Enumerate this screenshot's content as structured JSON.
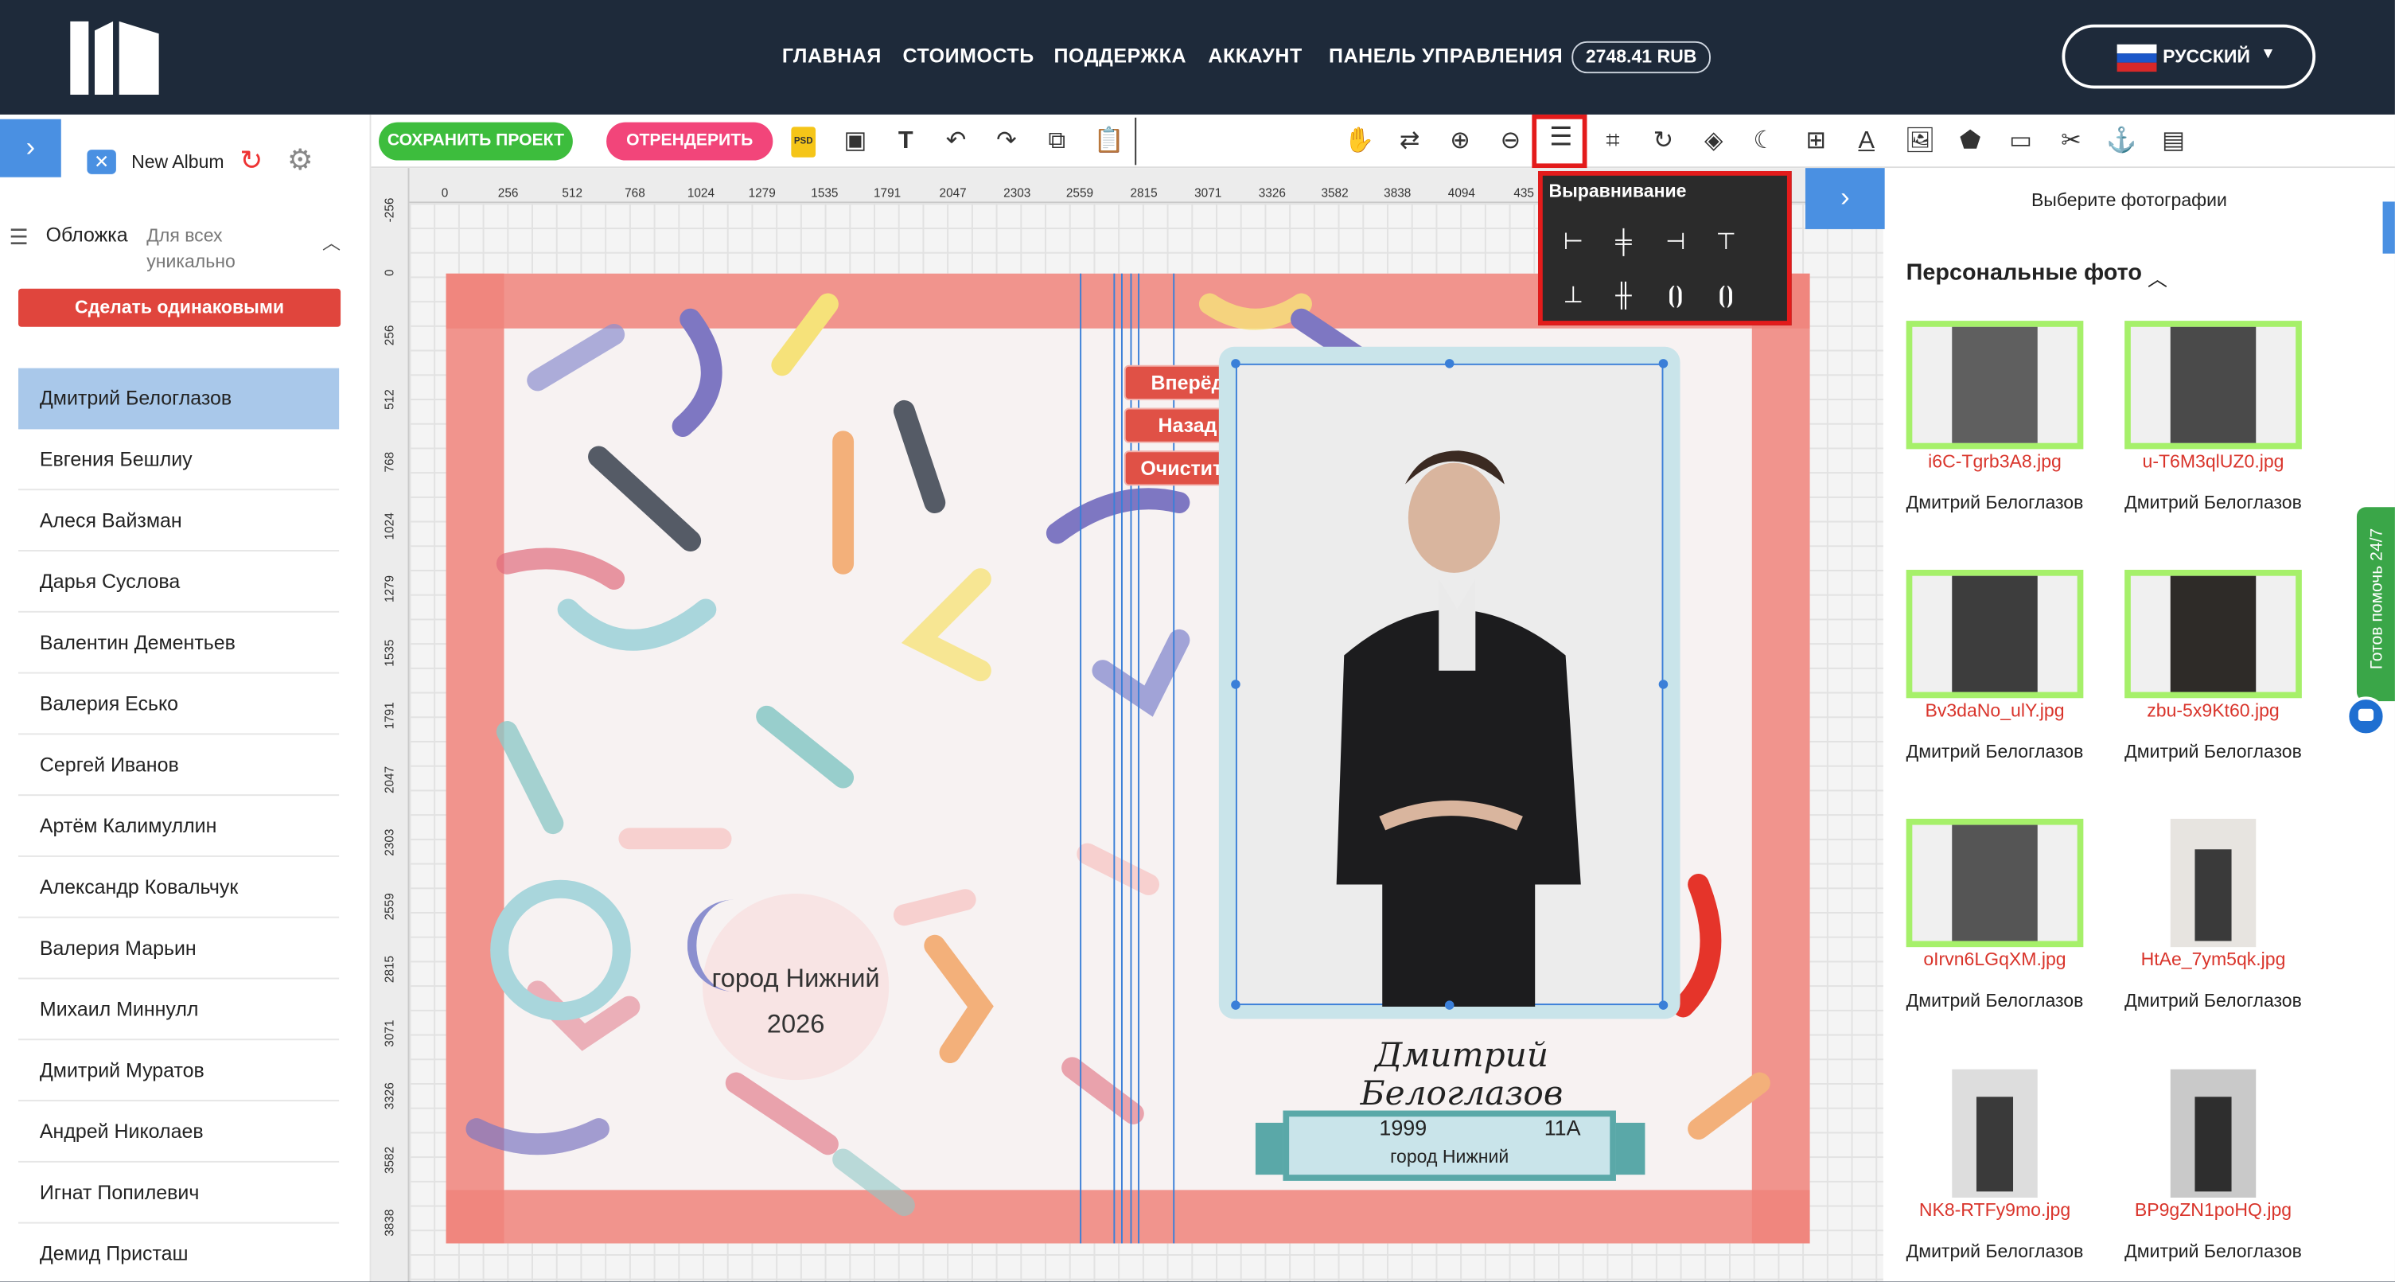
{
  "nav": {
    "links": [
      "ГЛАВНАЯ",
      "СТОИМОСТЬ",
      "ПОДДЕРЖКА",
      "АККАУНТ",
      "ПАНЕЛЬ УПРАВЛЕНИЯ"
    ],
    "balance": "2748.41 RUB",
    "language": "РУССКИЙ"
  },
  "album": {
    "name": "New Album"
  },
  "cover": {
    "label": "Обложка",
    "mode": "Для всех уникально",
    "make_same_button": "Сделать одинаковыми"
  },
  "people": [
    "Дмитрий Белоглазов",
    "Евгения Бешлиу",
    "Алеся Вайзман",
    "Дарья Суслова",
    "Валентин Дементьев",
    "Валерия Есько",
    "Сергей Иванов",
    "Артём Калимуллин",
    "Александр Ковальчук",
    "Валерия Марьин",
    "Михаил Миннулл",
    "Дмитрий Муратов",
    "Андрей Николаев",
    "Игнат Попилевич",
    "Демид Присташ"
  ],
  "toolbar": {
    "save_button": "СОХРАНИТЬ ПРОЕКТ",
    "render_button": "ОТРЕНДЕРИТЬ",
    "psd_label": "PSD"
  },
  "ruler": {
    "top": [
      "0",
      "256",
      "512",
      "768",
      "1024",
      "1279",
      "1535",
      "1791",
      "2047",
      "2303",
      "2559",
      "2815",
      "3071",
      "3326",
      "3582",
      "3838",
      "4094",
      "435"
    ],
    "left": [
      "-256",
      "0",
      "256",
      "512",
      "768",
      "1024",
      "1279",
      "1535",
      "1791",
      "2047",
      "2303",
      "2559",
      "2815",
      "3071",
      "3326",
      "3582",
      "3838"
    ]
  },
  "layer_buttons": [
    "Вперёд",
    "Назад",
    "Очистить"
  ],
  "cover_page": {
    "city_line1": "город Нижний",
    "city_line2": "2026",
    "signature": "Дмитрий Белоглазов",
    "year": "1999",
    "class": "11А",
    "city_small": "город Нижний"
  },
  "align_popup": {
    "title": "Выравнивание"
  },
  "right_panel": {
    "header": "Выберите фотографии",
    "section_title": "Персональные фото",
    "photos": [
      {
        "file": "i6C-Tgrb3A8.jpg",
        "person": "Дмитрий Белоглазов",
        "selected": true
      },
      {
        "file": "u-T6M3qlUZ0.jpg",
        "person": "Дмитрий Белоглазов",
        "selected": true
      },
      {
        "file": "Bv3daNo_ulY.jpg",
        "person": "Дмитрий Белоглазов",
        "selected": true
      },
      {
        "file": "zbu-5x9Kt60.jpg",
        "person": "Дмитрий Белоглазов",
        "selected": true
      },
      {
        "file": "oIrvn6LGqXM.jpg",
        "person": "Дмитрий Белоглазов",
        "selected": true
      },
      {
        "file": "HtAe_7ym5qk.jpg",
        "person": "Дмитрий Белоглазов",
        "selected": false
      },
      {
        "file": "NK8-RTFy9mo.jpg",
        "person": "Дмитрий Белоглазов",
        "selected": false
      },
      {
        "file": "BP9gZN1poHQ.jpg",
        "person": "Дмитрий Белоглазов",
        "selected": false
      }
    ]
  },
  "help_tab": "Готов помочь 24/7",
  "colors": {
    "nav_bg": "#1e2a3a",
    "save_green": "#3dbd3d",
    "render_pink": "#f2457a",
    "accent_blue": "#4a90e2",
    "highlight_red": "#e31b1b",
    "selected_green": "#a6f06a",
    "filename_red": "#d9342b"
  },
  "icons": [
    "logo",
    "chevron-right-icon",
    "close-icon",
    "refresh-icon",
    "gear-icon",
    "list-icon",
    "chevron-up-icon",
    "hand-icon",
    "zoom-in-icon",
    "zoom-out-icon",
    "align-icon",
    "crop-icon",
    "rotate-icon",
    "layers-icon",
    "moon-icon",
    "text-icon",
    "image-icon",
    "shape-icon",
    "scissors-icon",
    "anchor-icon",
    "chat-icon"
  ]
}
